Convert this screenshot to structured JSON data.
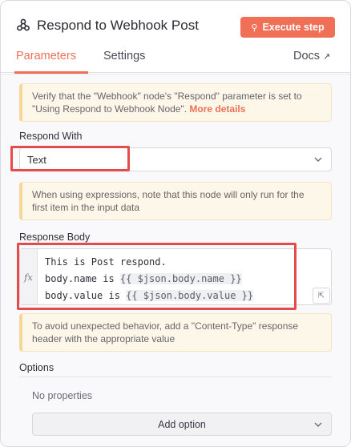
{
  "header": {
    "node_title": "Respond to Webhook Post",
    "execute_label": "Execute step"
  },
  "tabs": {
    "parameters": "Parameters",
    "settings": "Settings",
    "docs": "Docs"
  },
  "notices": {
    "webhook_text": "Verify that the \"Webhook\" node's \"Respond\" parameter is set to \"Using Respond to Webhook Node\".",
    "webhook_link": "More details",
    "expressions_text": "When using expressions, note that this node will only run for the first item in the input data",
    "content_type_text": "To avoid unexpected behavior, add a \"Content-Type\" response header with the appropriate value"
  },
  "respond_with": {
    "label": "Respond With",
    "value": "Text"
  },
  "response_body": {
    "label": "Response Body",
    "fx": "fx",
    "line1": "This is Post respond.",
    "line2_prefix": "body.name is ",
    "line2_expr": "{{ $json.body.name }}",
    "line3_prefix": "body.value is ",
    "line3_expr": "{{ $json.body.value }}"
  },
  "options": {
    "label": "Options",
    "empty_text": "No properties",
    "add_label": "Add option"
  },
  "icons": {
    "node": "webhook-icon",
    "execute": "flask-icon",
    "docs": "external-link-icon",
    "expand": "expand-icon"
  },
  "colors": {
    "accent": "#f07057",
    "highlight": "#e54b4b",
    "notice_bg": "#fdf7ea"
  }
}
